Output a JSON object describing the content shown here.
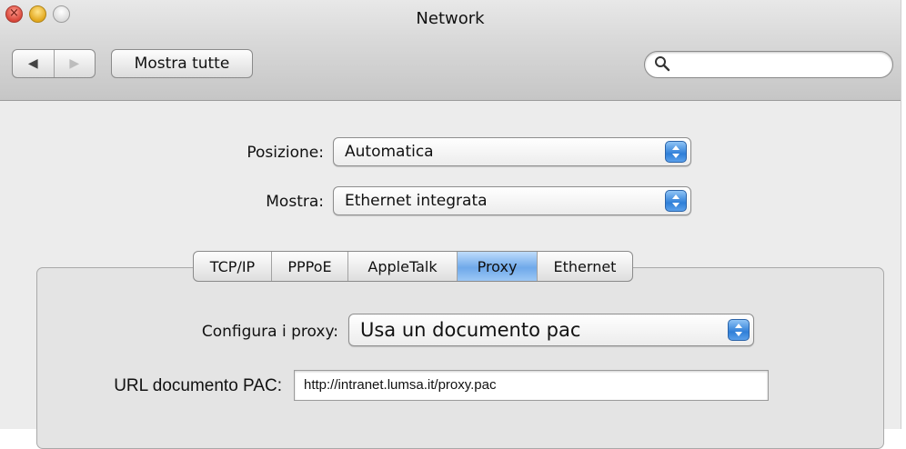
{
  "window": {
    "title": "Network"
  },
  "toolbar": {
    "back_icon": "◀",
    "forward_icon": "▶",
    "show_all_label": "Mostra tutte",
    "search_value": ""
  },
  "location": {
    "label": "Posizione:",
    "value": "Automatica"
  },
  "show": {
    "label": "Mostra:",
    "value": "Ethernet integrata"
  },
  "tabs": [
    {
      "label": "TCP/IP",
      "active": false
    },
    {
      "label": "PPPoE",
      "active": false
    },
    {
      "label": "AppleTalk",
      "active": false
    },
    {
      "label": "Proxy",
      "active": true
    },
    {
      "label": "Ethernet",
      "active": false
    }
  ],
  "proxy": {
    "configure_label": "Configura i proxy:",
    "configure_value": "Usa un documento pac",
    "pac_url_label": "URL documento PAC:",
    "pac_url_value": "http://intranet.lumsa.it/proxy.pac"
  },
  "colors": {
    "accent": "#2f7fd8",
    "tab_active": "#6fa9ea",
    "window_bg": "#ececec"
  }
}
